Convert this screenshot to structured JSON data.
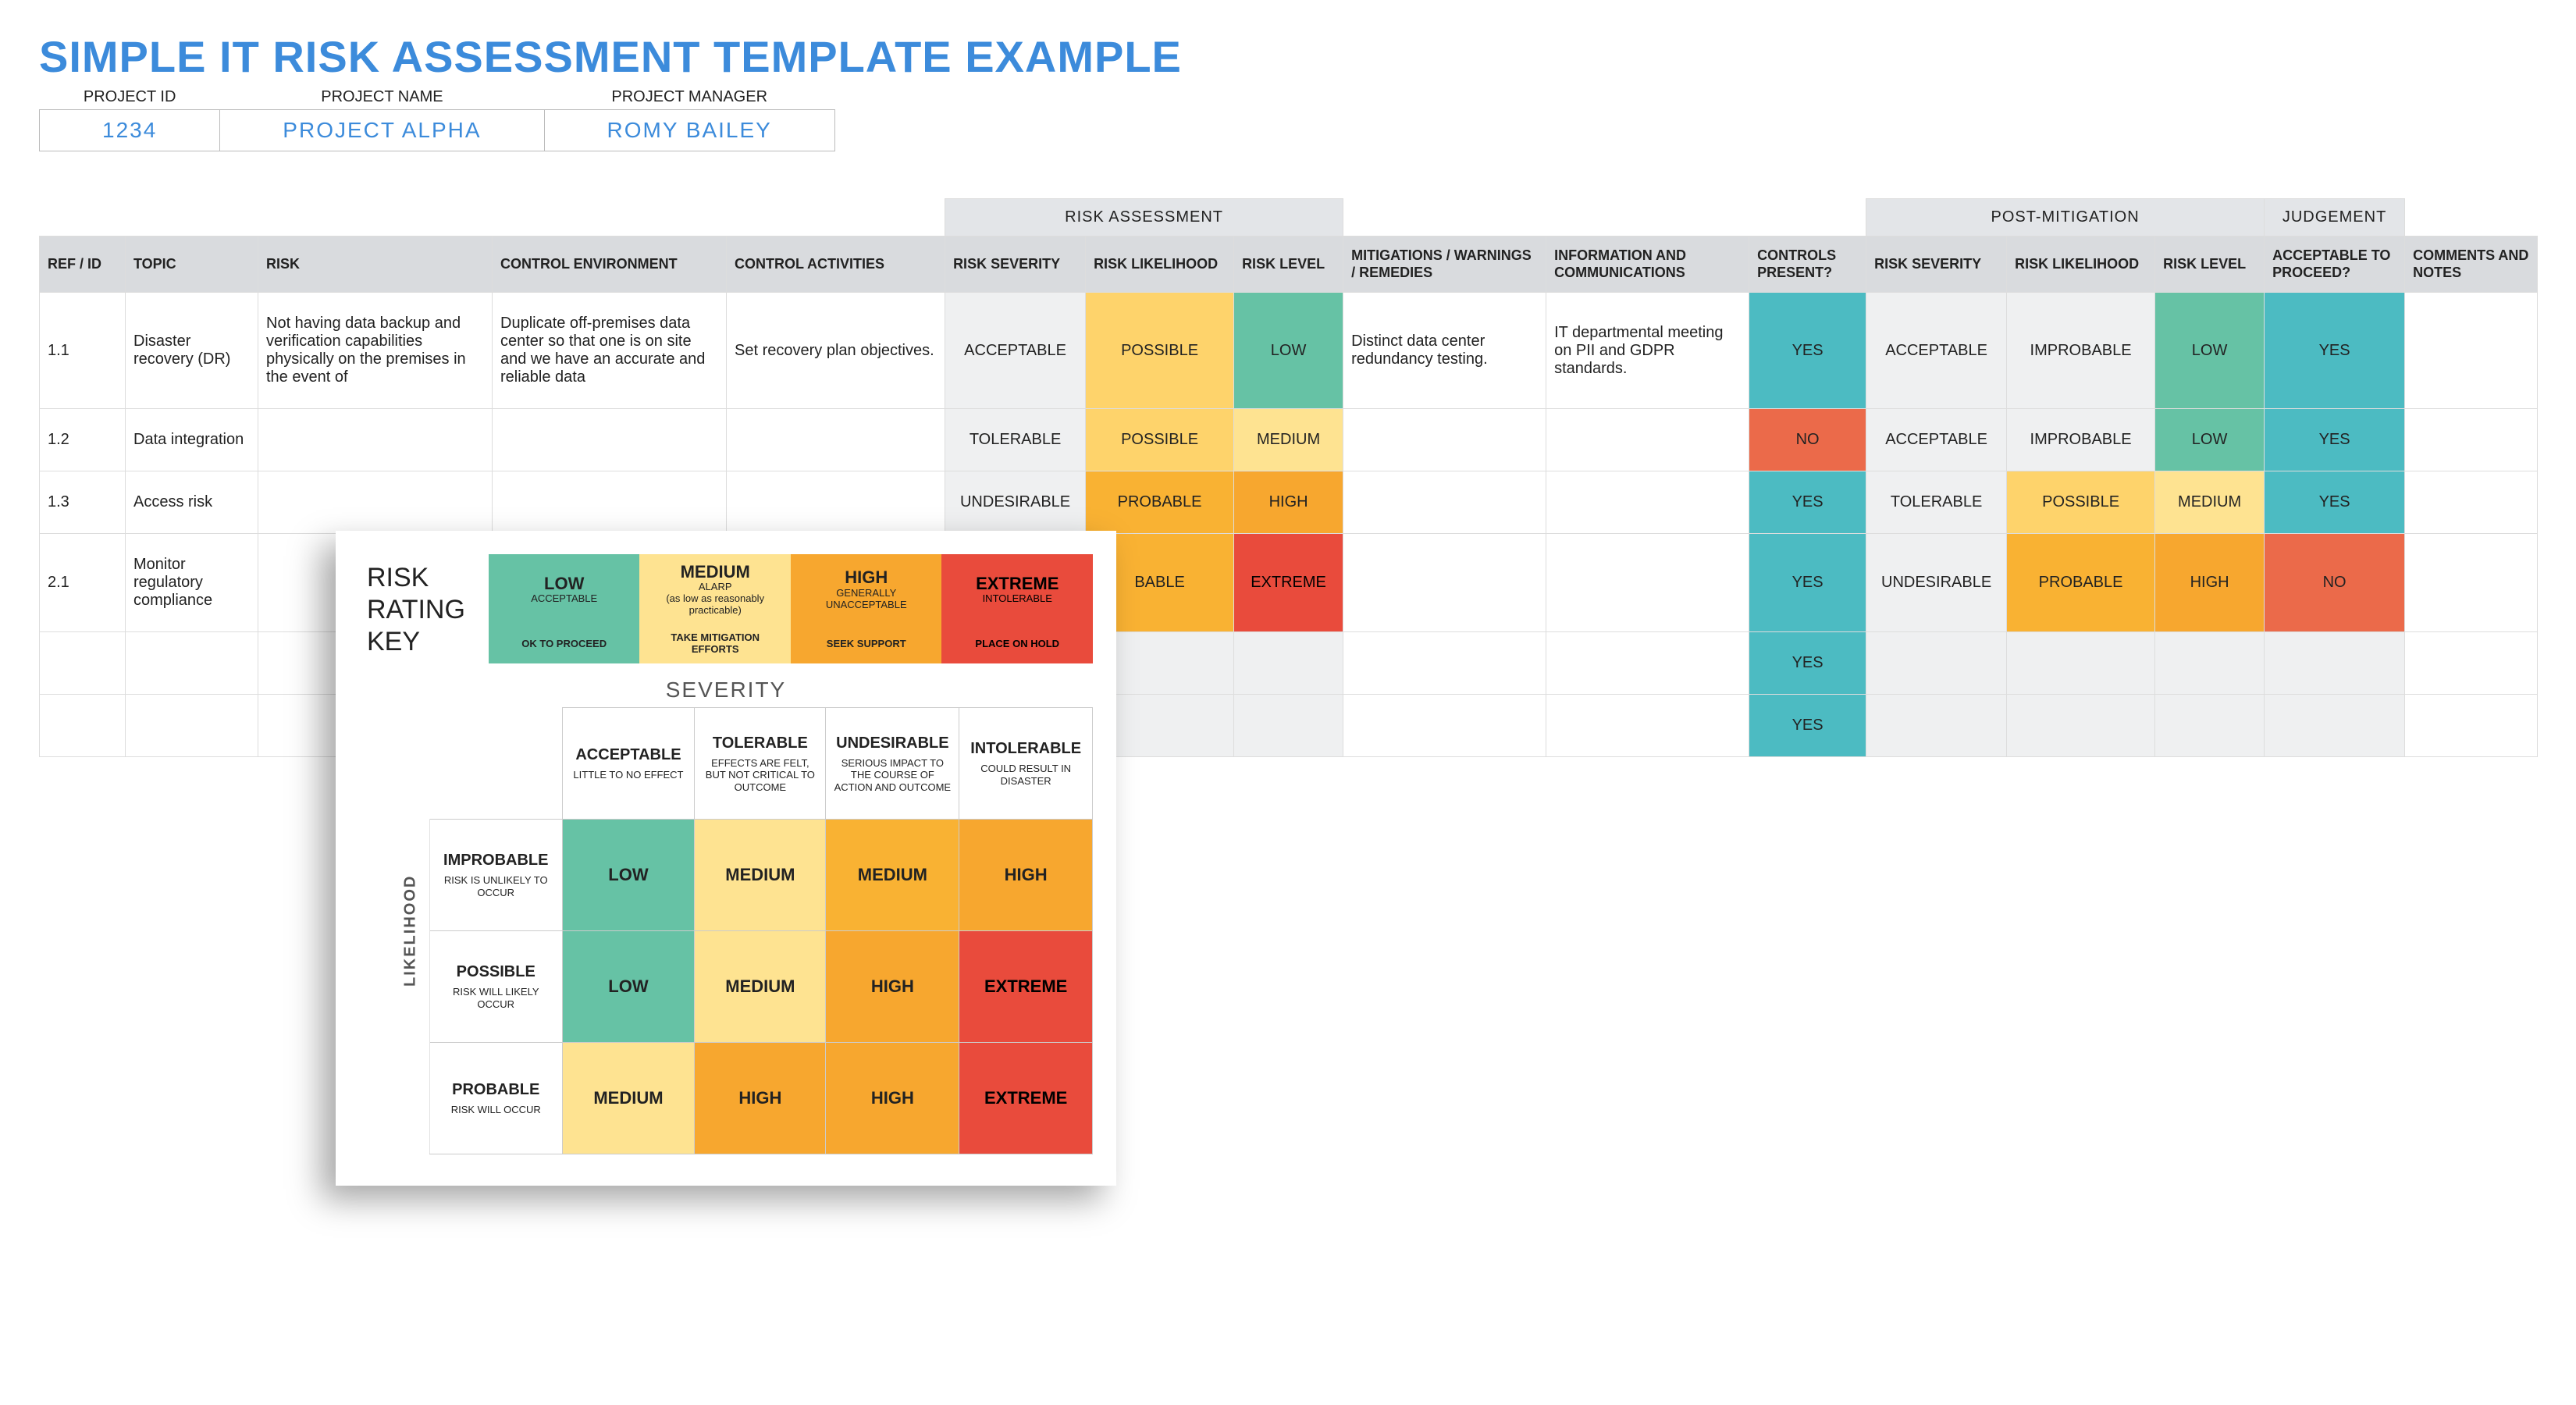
{
  "title": "SIMPLE IT RISK ASSESSMENT TEMPLATE EXAMPLE",
  "header": {
    "labels": {
      "id": "PROJECT ID",
      "name": "PROJECT NAME",
      "mgr": "PROJECT MANAGER"
    },
    "id": "1234",
    "name": "PROJECT ALPHA",
    "mgr": "ROMY BAILEY"
  },
  "groups": {
    "risk": "RISK ASSESSMENT",
    "post": "POST-MITIGATION",
    "judge": "JUDGEMENT"
  },
  "cols": {
    "ref": "REF / ID",
    "topic": "TOPIC",
    "risk": "RISK",
    "cenv": "CONTROL ENVIRONMENT",
    "cact": "CONTROL ACTIVITIES",
    "rsev": "RISK SEVERITY",
    "rlik": "RISK LIKELIHOOD",
    "rlvl": "RISK LEVEL",
    "mit": "MITIGATIONS / WARNINGS / REMEDIES",
    "info": "INFORMATION AND COMMUNICATIONS",
    "ctrl": "CONTROLS PRESENT?",
    "psev": "RISK SEVERITY",
    "plik": "RISK LIKELIHOOD",
    "plvl": "RISK LEVEL",
    "acc": "ACCEPTABLE TO PROCEED?",
    "notes": "COMMENTS AND NOTES"
  },
  "rows": [
    {
      "ref": "1.1",
      "topic": "Disaster recovery (DR)",
      "risk": "Not having data backup and verification capabilities physically on the premises in the event of",
      "cenv": "Duplicate off-premises data center so that one is on site and we have an accurate and reliable data",
      "cact": "Set recovery plan objectives.",
      "rsev": "ACCEPTABLE",
      "rlik": "POSSIBLE",
      "rlvl": "LOW",
      "mit": "Distinct data center redundancy testing.",
      "info": "IT departmental meeting on PII and GDPR standards.",
      "ctrl": "YES",
      "psev": "ACCEPTABLE",
      "plik": "IMPROBABLE",
      "plvl": "LOW",
      "acc": "YES"
    },
    {
      "ref": "1.2",
      "topic": "Data integration",
      "rsev": "TOLERABLE",
      "rlik": "POSSIBLE",
      "rlvl": "MEDIUM",
      "ctrl": "NO",
      "psev": "ACCEPTABLE",
      "plik": "IMPROBABLE",
      "plvl": "LOW",
      "acc": "YES"
    },
    {
      "ref": "1.3",
      "topic": "Access risk",
      "rsev": "UNDESIRABLE",
      "rlik": "PROBABLE",
      "rlvl": "HIGH",
      "ctrl": "YES",
      "psev": "TOLERABLE",
      "plik": "POSSIBLE",
      "plvl": "MEDIUM",
      "acc": "YES"
    },
    {
      "ref": "2.1",
      "topic": "Monitor regulatory compliance",
      "rlik": "BABLE",
      "rlvl": "EXTREME",
      "ctrl": "YES",
      "psev": "UNDESIRABLE",
      "plik": "PROBABLE",
      "plvl": "HIGH",
      "acc": "NO"
    },
    {
      "ctrl": "YES"
    },
    {
      "ctrl": "YES"
    }
  ],
  "key": {
    "title": "RISK\nRATING\nKEY",
    "levels": [
      {
        "name": "LOW",
        "sub": "ACCEPTABLE",
        "action": "OK TO PROCEED",
        "cls": "c-low"
      },
      {
        "name": "MEDIUM",
        "sub": "ALARP\n(as low as reasonably practicable)",
        "action": "TAKE MITIGATION EFFORTS",
        "cls": "c-med"
      },
      {
        "name": "HIGH",
        "sub": "GENERALLY UNACCEPTABLE",
        "action": "SEEK SUPPORT",
        "cls": "c-high"
      },
      {
        "name": "EXTREME",
        "sub": "INTOLERABLE",
        "action": "PLACE ON HOLD",
        "cls": "c-extreme"
      }
    ],
    "sev_title": "SEVERITY",
    "lik_title": "LIKELIHOOD",
    "sev_cols": [
      {
        "name": "ACCEPTABLE",
        "sub": "LITTLE TO NO EFFECT"
      },
      {
        "name": "TOLERABLE",
        "sub": "EFFECTS ARE FELT, BUT NOT CRITICAL TO OUTCOME"
      },
      {
        "name": "UNDESIRABLE",
        "sub": "SERIOUS IMPACT TO THE COURSE OF ACTION AND OUTCOME"
      },
      {
        "name": "INTOLERABLE",
        "sub": "COULD RESULT IN DISASTER"
      }
    ],
    "lik_rows": [
      {
        "name": "IMPROBABLE",
        "sub": "RISK IS UNLIKELY TO OCCUR",
        "cells": [
          {
            "v": "LOW",
            "c": "c-low"
          },
          {
            "v": "MEDIUM",
            "c": "c-med"
          },
          {
            "v": "MEDIUM",
            "c": "c-amber"
          },
          {
            "v": "HIGH",
            "c": "c-high"
          }
        ]
      },
      {
        "name": "POSSIBLE",
        "sub": "RISK WILL LIKELY OCCUR",
        "cells": [
          {
            "v": "LOW",
            "c": "c-low"
          },
          {
            "v": "MEDIUM",
            "c": "c-med"
          },
          {
            "v": "HIGH",
            "c": "c-high"
          },
          {
            "v": "EXTREME",
            "c": "c-extreme"
          }
        ]
      },
      {
        "name": "PROBABLE",
        "sub": "RISK WILL OCCUR",
        "cells": [
          {
            "v": "MEDIUM",
            "c": "c-med"
          },
          {
            "v": "HIGH",
            "c": "c-high"
          },
          {
            "v": "HIGH",
            "c": "c-high"
          },
          {
            "v": "EXTREME",
            "c": "c-extreme"
          }
        ]
      }
    ]
  }
}
